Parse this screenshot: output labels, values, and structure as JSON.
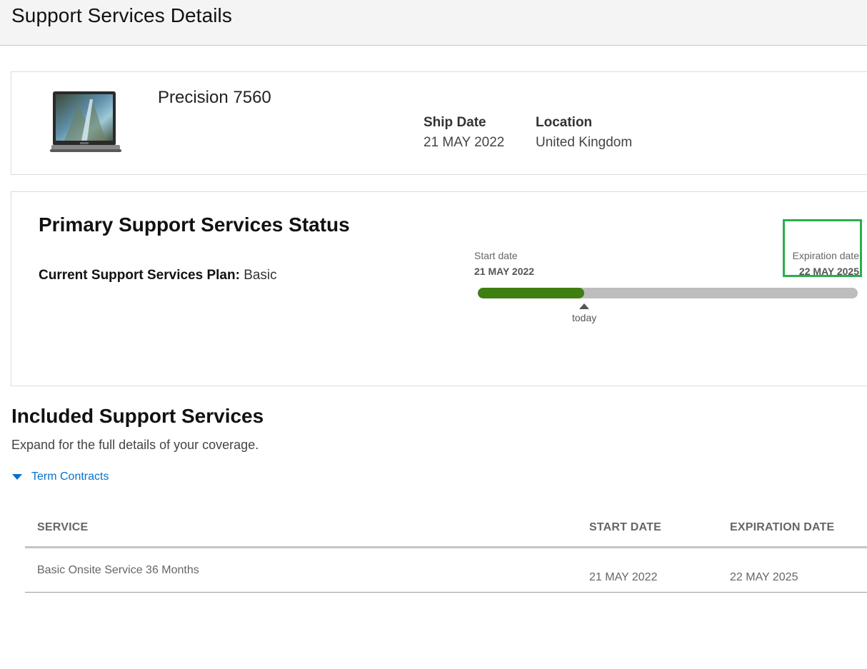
{
  "page": {
    "title": "Support Services Details"
  },
  "product": {
    "name": "Precision 7560",
    "image_icon": "laptop-icon",
    "ship_date_label": "Ship Date",
    "ship_date": "21 MAY 2022",
    "location_label": "Location",
    "location": "United Kingdom"
  },
  "status": {
    "title": "Primary Support Services Status",
    "plan_label": "Current Support Services Plan:",
    "plan_value": "Basic",
    "start_label": "Start date",
    "start_date": "21 MAY 2022",
    "expiration_label": "Expiration date",
    "expiration_date": "22 MAY 2025",
    "today_label": "today",
    "progress_fraction": 0.28,
    "colors": {
      "progress": "#3f7e10",
      "track": "#bdbdbd",
      "highlight": "#2bae4e"
    }
  },
  "included": {
    "title": "Included Support Services",
    "subtitle": "Expand for the full details of your coverage.",
    "toggle_label": "Term Contracts",
    "toggle_icon": "caret-down-icon",
    "link_color": "#0672cb"
  },
  "table": {
    "headers": [
      "SERVICE",
      "START DATE",
      "EXPIRATION DATE"
    ],
    "rows": [
      [
        "Basic Onsite Service 36 Months",
        "21 MAY 2022",
        "22 MAY 2025"
      ]
    ]
  }
}
